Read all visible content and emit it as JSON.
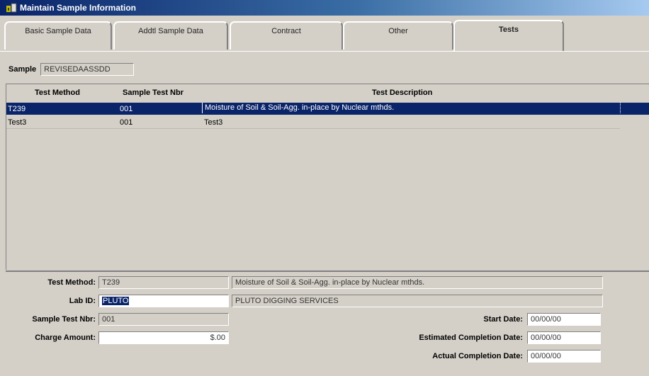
{
  "window": {
    "title": "Maintain Sample Information"
  },
  "tabs": [
    {
      "label": "Basic Sample Data",
      "active": false
    },
    {
      "label": "Addtl Sample Data",
      "active": false
    },
    {
      "label": "Contract",
      "active": false
    },
    {
      "label": "Other",
      "active": false
    },
    {
      "label": "Tests",
      "active": true
    }
  ],
  "sample": {
    "label": "Sample",
    "value": "REVISEDAASSDD"
  },
  "grid": {
    "columns": [
      "Test Method",
      "Sample Test Nbr",
      "Test Description"
    ],
    "rows": [
      {
        "test_method": "T239",
        "sample_test_nbr": "001",
        "test_description": "Moisture of Soil & Soil-Agg. in-place by Nuclear mthds.",
        "selected": true
      },
      {
        "test_method": "Test3",
        "sample_test_nbr": "001",
        "test_description": "Test3",
        "selected": false
      }
    ]
  },
  "detail": {
    "test_method_label": "Test Method:",
    "test_method_value": "T239",
    "test_description_value": "Moisture of Soil & Soil-Agg. in-place by Nuclear mthds.",
    "lab_id_label": "Lab ID:",
    "lab_id_value": "PLUTO",
    "lab_name_value": "PLUTO DIGGING SERVICES",
    "sample_test_nbr_label": "Sample Test Nbr:",
    "sample_test_nbr_value": "001",
    "charge_amount_label": "Charge Amount:",
    "charge_amount_value": "$.00",
    "start_date_label": "Start Date:",
    "start_date_value": "00/00/00",
    "est_completion_label": "Estimated Completion Date:",
    "est_completion_value": "00/00/00",
    "actual_completion_label": "Actual Completion Date:",
    "actual_completion_value": "00/00/00"
  },
  "colors": {
    "selection": "#0a246a",
    "face": "#d4d0c8"
  },
  "icons": {
    "app": "oracle-forms-icon"
  }
}
